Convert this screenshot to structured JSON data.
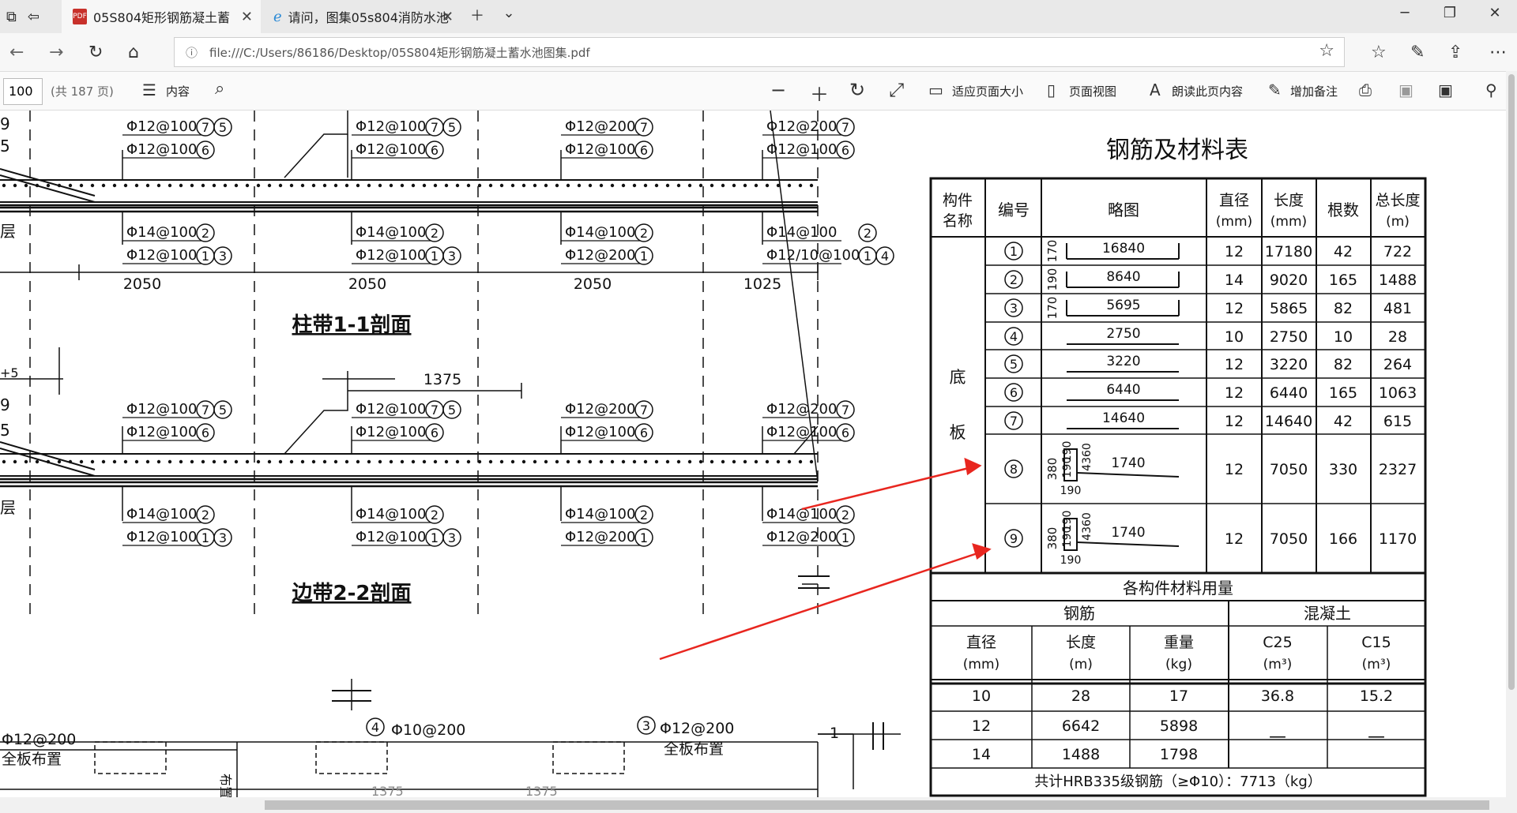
{
  "tabs": [
    {
      "label": "05S804矩形钢筋凝土蓄",
      "active": true
    },
    {
      "label": "请问，图集05s804消防水池",
      "active": false
    }
  ],
  "address": {
    "url": "file:///C:/Users/86186/Desktop/05S804矩形钢筋凝土蓄水池图集.pdf"
  },
  "pdf_toolbar": {
    "page_number": "100",
    "page_total": "(共 187 页)",
    "contents_label": "内容",
    "fit_page_label": "适应页面大小",
    "page_view_label": "页面视图",
    "read_aloud_label": "朗读此页内容",
    "add_note_label": "增加备注"
  },
  "drawing": {
    "section1_title": "柱带1-1剖面",
    "section2_title": "边带2-2剖面",
    "dims": [
      "2050",
      "2050",
      "2050",
      "1025"
    ],
    "dim_1375": "1375",
    "left_frag_1": "9",
    "left_frag_2": "5",
    "left_frag_3": "层",
    "left_frag_4": "9",
    "left_frag_5": "5",
    "left_frag_6": "层",
    "left_frag_7": "+5",
    "s1_top": [
      {
        "a": "Φ12@100",
        "b": "Φ12@100",
        "n1": "7",
        "n2": "5",
        "n3": "6"
      },
      {
        "a": "Φ12@100",
        "b": "Φ12@100",
        "n1": "7",
        "n2": "5",
        "n3": "6"
      },
      {
        "a": "Φ12@200",
        "b": "Φ12@100",
        "n1": "7",
        "n2": "",
        "n3": "6"
      },
      {
        "a": "Φ12@200",
        "b": "Φ12@100",
        "n1": "7",
        "n2": "",
        "n3": "6"
      }
    ],
    "s1_bot": [
      {
        "a": "Φ14@100",
        "b": "Φ12@100",
        "n1": "2",
        "n2": "1",
        "n3": "3"
      },
      {
        "a": "Φ14@100",
        "b": "Φ12@100",
        "n1": "2",
        "n2": "1",
        "n3": "3"
      },
      {
        "a": "Φ14@100",
        "b": "Φ12@200",
        "n1": "2",
        "n2": "1",
        "n3": ""
      },
      {
        "a": "Φ14@100",
        "b": "Φ12/10@100",
        "n1": "2",
        "n2": "1",
        "n3": "4"
      }
    ],
    "s2_top": [
      {
        "a": "Φ12@100",
        "b": "Φ12@100",
        "n1": "7",
        "n2": "5",
        "n3": "6"
      },
      {
        "a": "Φ12@100",
        "b": "Φ12@100",
        "n1": "7",
        "n2": "5",
        "n3": "6"
      },
      {
        "a": "Φ12@200",
        "b": "Φ12@100",
        "n1": "7",
        "n2": "",
        "n3": "6"
      },
      {
        "a": "Φ12@200",
        "b": "Φ12@100",
        "n1": "7",
        "n2": "",
        "n3": "6"
      }
    ],
    "s2_bot": [
      {
        "a": "Φ14@100",
        "b": "Φ12@100",
        "n1": "2",
        "n2": "1",
        "n3": "3"
      },
      {
        "a": "Φ14@100",
        "b": "Φ12@100",
        "n1": "2",
        "n2": "1",
        "n3": "3"
      },
      {
        "a": "Φ14@100",
        "b": "Φ12@200",
        "n1": "2",
        "n2": "1",
        "n3": ""
      },
      {
        "a": "Φ14@100",
        "b": "Φ12@200",
        "n1": "2",
        "n2": "1",
        "n3": ""
      }
    ],
    "bottom_labels": {
      "l1": "Φ12@200",
      "l2": "全板布置",
      "l3": "4",
      "l4": "Φ10@200",
      "l5": "3",
      "l6": "Φ12@200",
      "l7": "全板布置",
      "l8": "1",
      "l9": "布置",
      "l10": "1375",
      "l11": "1375"
    }
  },
  "rebar_table": {
    "title": "钢筋及材料表",
    "headers": [
      "构件名称",
      "编号",
      "略图",
      "直径(mm)",
      "长度(mm)",
      "根数",
      "总长度(m)"
    ],
    "component": "底板",
    "rows": [
      {
        "no": "1",
        "sketch": "16840",
        "side": "170",
        "d": "12",
        "len": "17180",
        "count": "42",
        "total": "722"
      },
      {
        "no": "2",
        "sketch": "8640",
        "side": "190",
        "d": "14",
        "len": "9020",
        "count": "165",
        "total": "1488"
      },
      {
        "no": "3",
        "sketch": "5695",
        "side": "170",
        "d": "12",
        "len": "5865",
        "count": "82",
        "total": "481"
      },
      {
        "no": "4",
        "sketch": "2750",
        "side": "",
        "d": "10",
        "len": "2750",
        "count": "10",
        "total": "28"
      },
      {
        "no": "5",
        "sketch": "3220",
        "side": "",
        "d": "12",
        "len": "3220",
        "count": "82",
        "total": "264"
      },
      {
        "no": "6",
        "sketch": "6440",
        "side": "",
        "d": "12",
        "len": "6440",
        "count": "165",
        "total": "1063"
      },
      {
        "no": "7",
        "sketch": "14640",
        "side": "",
        "d": "12",
        "len": "14640",
        "count": "42",
        "total": "615"
      },
      {
        "no": "8",
        "sketch": "1740",
        "side": "380",
        "d": "12",
        "len": "7050",
        "count": "330",
        "total": "2327"
      },
      {
        "no": "9",
        "sketch": "1740",
        "side": "380",
        "d": "12",
        "len": "7050",
        "count": "166",
        "total": "1170"
      }
    ],
    "hook_dims": {
      "a": "190",
      "b": "190",
      "c": "4360",
      "d": "190"
    },
    "material_title": "各构件材料用量",
    "steel_label": "钢筋",
    "concrete_label": "混凝土",
    "m_headers": [
      "直径(mm)",
      "长度(m)",
      "重量(kg)",
      "C25(m³)",
      "C15(m³)"
    ],
    "m_rows": [
      {
        "d": "10",
        "len": "28",
        "wt": "17"
      },
      {
        "d": "12",
        "len": "6642",
        "wt": "5898"
      },
      {
        "d": "14",
        "len": "1488",
        "wt": "1798"
      }
    ],
    "c25": "36.8",
    "c15": "15.2",
    "dash": "—",
    "total_note": "共计HRB335级钢筋（≥Φ10）：7713（kg）"
  }
}
